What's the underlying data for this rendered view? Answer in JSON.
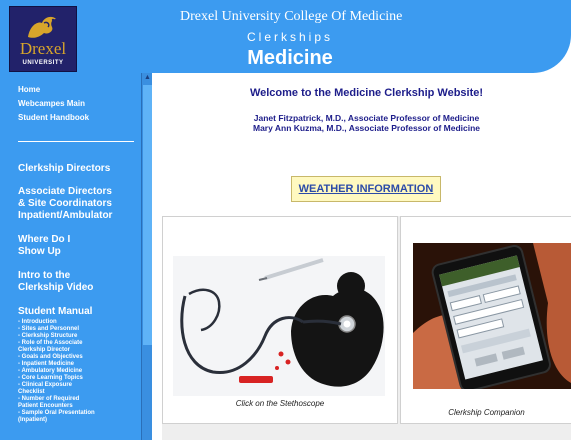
{
  "header": {
    "logo_word": "Drexel",
    "logo_subword": "UNIVERSITY",
    "college": "Drexel University College Of Medicine",
    "subtitle": "Clerkships",
    "title": "Medicine"
  },
  "sidebar": {
    "top_links": [
      "Home",
      "Webcampes Main",
      "Student Handbook"
    ],
    "clerkship_directors": "Clerkship Directors",
    "associate_directors": [
      "Associate Directors",
      "& Site Coordinators",
      "Inpatient/Ambulator"
    ],
    "where_do_i": [
      "Where Do I",
      "Show Up"
    ],
    "intro_video": [
      "Intro to the",
      "Clerkship Video"
    ],
    "student_manual": "Student Manual",
    "manual_items": [
      "- Introduction",
      "- Sites and Personnel",
      "- Clerkship Structure",
      "- Role of the Associate",
      "  Clerkship Director",
      "- Goals and Objectives",
      "- Inpatient Medicine",
      "- Ambulatory Medicine",
      "- Core Learning Topics",
      "- Clinical Exposure",
      "  Checklist",
      "- Number of Required",
      "  Patient Encounters",
      "- Sample Oral Presentation",
      "  (Inpatient)"
    ]
  },
  "main": {
    "welcome": "Welcome to the Medicine Clerkship Website!",
    "faculty": [
      "Janet Fitzpatrick, M.D., Associate Professor of Medicine",
      "Mary Ann Kuzma, M.D., Associate Professor of Medicine"
    ],
    "weather_link": "WEATHER INFORMATION",
    "left_caption": "Click on the Stethoscope",
    "right_caption": "Clerkship Companion"
  },
  "colors": {
    "brand_blue": "#3c9bf0",
    "heading_navy": "#1d1d8a",
    "weather_bg": "#fff9c0"
  }
}
